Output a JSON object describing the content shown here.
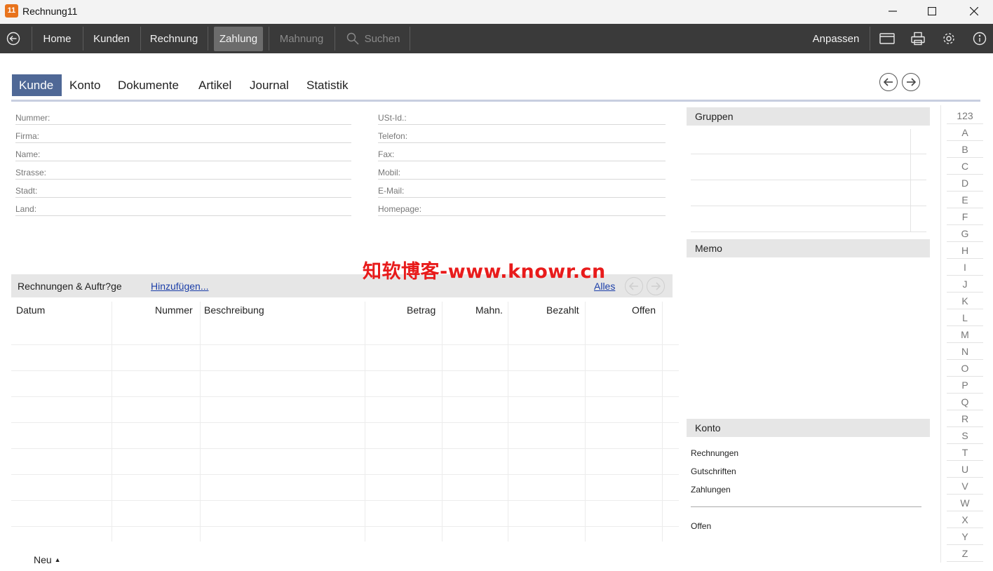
{
  "window": {
    "title": "Rechnung11",
    "app_icon_text": "11"
  },
  "menubar": {
    "items": [
      {
        "label": "Home"
      },
      {
        "label": "Kunden"
      },
      {
        "label": "Rechnung"
      },
      {
        "label": "Zahlung",
        "active": true
      },
      {
        "label": "Mahnung",
        "disabled": true
      },
      {
        "label": "Suchen",
        "disabled": true
      }
    ],
    "customize_label": "Anpassen",
    "icons": [
      "back-icon",
      "search-icon",
      "window-icon",
      "printer-icon",
      "gear-icon",
      "info-icon"
    ]
  },
  "tabs": [
    "Kunde",
    "Konto",
    "Dokumente",
    "Artikel",
    "Journal",
    "Statistik"
  ],
  "fields_left": [
    "Nummer:",
    "Firma:",
    "Name:",
    "Strasse:",
    "Stadt:",
    "Land:"
  ],
  "fields_right": [
    "USt-Id.:",
    "Telefon:",
    "Fax:",
    "Mobil:",
    "E-Mail:",
    "Homepage:"
  ],
  "invoices": {
    "title": "Rechnungen & Auftr?ge",
    "add_link": "Hinzufügen...",
    "all_link": "Alles",
    "columns": [
      "Datum",
      "Nummer",
      "Beschreibung",
      "Betrag",
      "Mahn.",
      "Bezahlt",
      "Offen"
    ]
  },
  "groups": {
    "title": "Gruppen"
  },
  "memo": {
    "title": "Memo"
  },
  "konto": {
    "title": "Konto",
    "rows": [
      "Rechnungen",
      "Gutschriften",
      "Zahlungen"
    ],
    "total_label": "Offen"
  },
  "alphabet": [
    "123",
    "A",
    "B",
    "C",
    "D",
    "E",
    "F",
    "G",
    "H",
    "I",
    "J",
    "K",
    "L",
    "M",
    "N",
    "O",
    "P",
    "Q",
    "R",
    "S",
    "T",
    "U",
    "V",
    "W",
    "X",
    "Y",
    "Z"
  ],
  "footer": {
    "new_label": "Neu"
  },
  "watermark": "知软博客-www.knowr.cn",
  "colors": {
    "menubar": "#3a3a3a",
    "active_tab": "#4f6896",
    "link": "#1b3ea8",
    "watermark": "#e81b1b"
  }
}
